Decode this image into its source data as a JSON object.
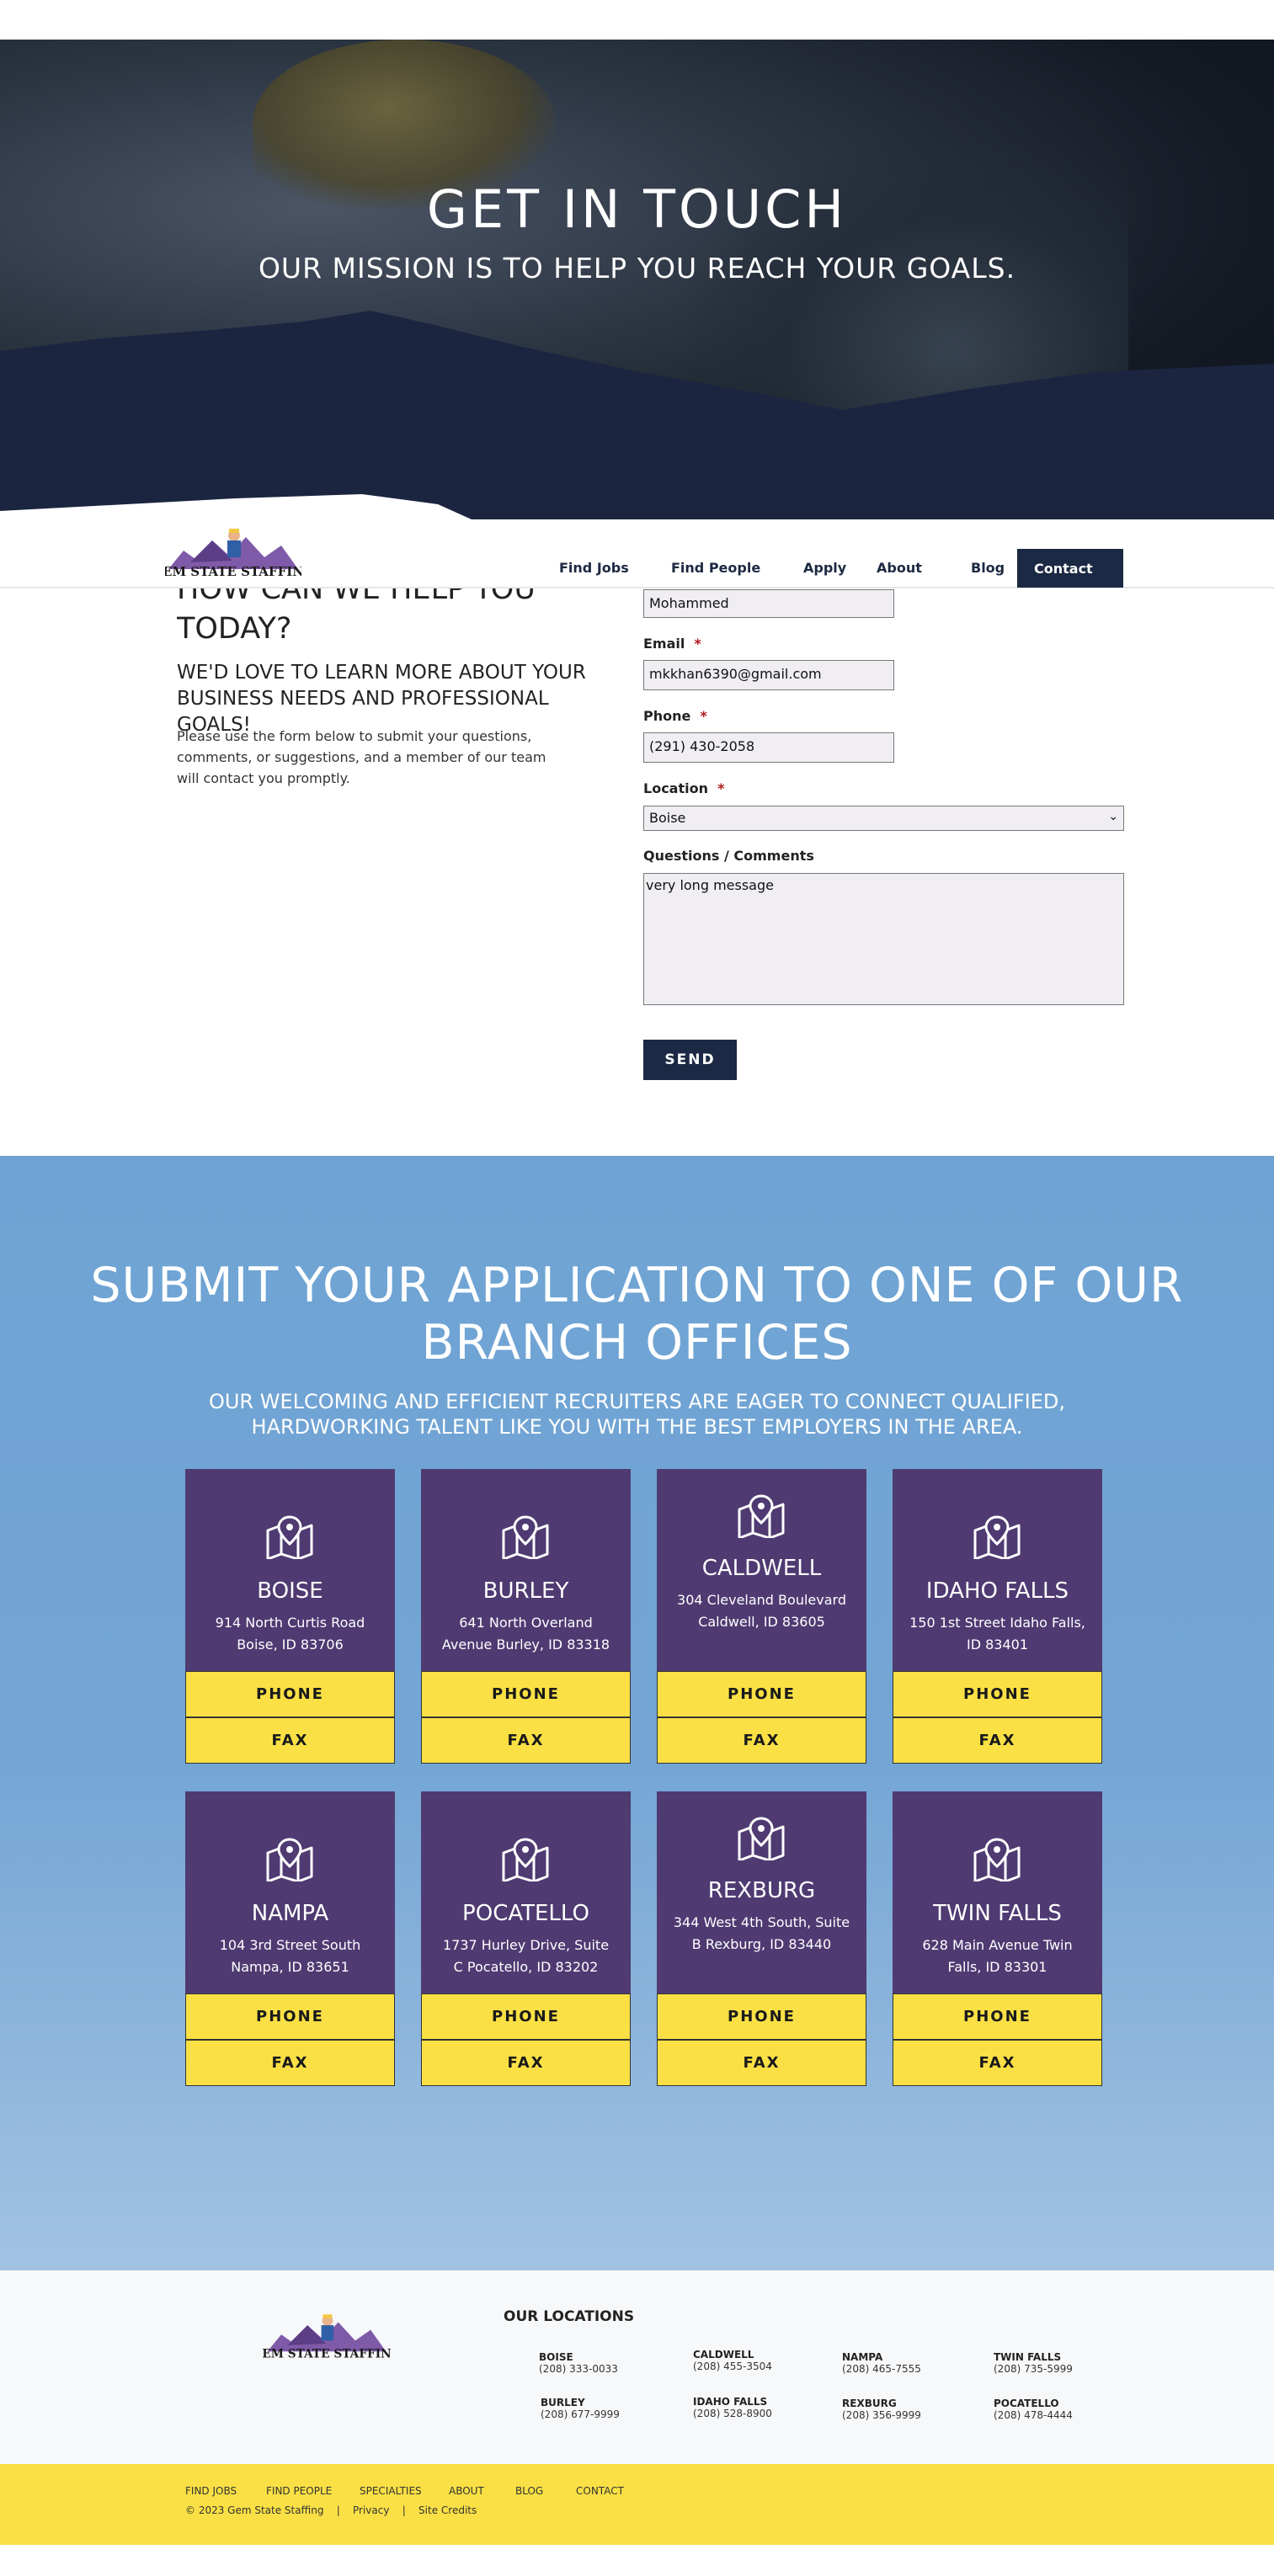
{
  "hero": {
    "title": "GET IN TOUCH",
    "subtitle": "OUR MISSION IS TO HELP YOU REACH YOUR GOALS."
  },
  "nav": {
    "logo_text": "GEM STATE STAFFING",
    "links": [
      "Find Jobs",
      "Find People",
      "Apply",
      "About",
      "Blog"
    ],
    "contact": "Contact"
  },
  "intro": {
    "title": "HOW CAN WE HELP YOU TODAY?",
    "subtitle": "WE'D LOVE TO LEARN MORE ABOUT YOUR BUSINESS NEEDS AND PROFESSIONAL GOALS!",
    "text": "Please use the form below to submit your questions, comments, or suggestions, and a member of our team will contact you promptly."
  },
  "form": {
    "name_value": "Mohammed",
    "email_label": "Email",
    "email_value": "mkkhan6390@gmail.com",
    "phone_label": "Phone",
    "phone_value": "(291) 430-2058",
    "location_label": "Location",
    "location_value": "Boise",
    "comments_label": "Questions / Comments",
    "comments_value": "very long message",
    "required_mark": "*",
    "send": "SEND"
  },
  "branches": {
    "title": "SUBMIT YOUR APPLICATION TO ONE OF OUR BRANCH OFFICES",
    "subtitle": "OUR WELCOMING AND EFFICIENT RECRUITERS ARE EAGER TO CONNECT QUALIFIED, HARDWORKING TALENT LIKE YOU WITH THE BEST EMPLOYERS IN THE AREA.",
    "phone_label": "PHONE",
    "fax_label": "FAX",
    "offices": [
      {
        "name": "BOISE",
        "address": "914 North Curtis Road Boise, ID 83706"
      },
      {
        "name": "BURLEY",
        "address": "641 North Overland Avenue Burley, ID 83318"
      },
      {
        "name": "CALDWELL",
        "address": "304 Cleveland Boulevard Caldwell, ID 83605"
      },
      {
        "name": "IDAHO FALLS",
        "address": "150 1st Street Idaho Falls, ID 83401"
      },
      {
        "name": "NAMPA",
        "address": "104 3rd Street South Nampa, ID 83651"
      },
      {
        "name": "POCATELLO",
        "address": "1737 Hurley Drive, Suite C Pocatello, ID 83202"
      },
      {
        "name": "REXBURG",
        "address": "344 West 4th South, Suite B Rexburg, ID 83440"
      },
      {
        "name": "TWIN FALLS",
        "address": "628 Main Avenue Twin Falls, ID 83301"
      }
    ]
  },
  "footer": {
    "locations_title": "OUR LOCATIONS",
    "locations": [
      {
        "name": "BOISE",
        "phone": "(208) 333-0033"
      },
      {
        "name": "CALDWELL",
        "phone": "(208) 455-3504"
      },
      {
        "name": "NAMPA",
        "phone": "(208) 465-7555"
      },
      {
        "name": "TWIN FALLS",
        "phone": "(208) 735-5999"
      },
      {
        "name": "BURLEY",
        "phone": "(208) 677-9999"
      },
      {
        "name": "IDAHO FALLS",
        "phone": "(208) 528-8900"
      },
      {
        "name": "REXBURG",
        "phone": "(208) 356-9999"
      },
      {
        "name": "POCATELLO",
        "phone": "(208) 478-4444"
      }
    ],
    "links": [
      "FIND JOBS",
      "FIND PEOPLE",
      "SPECIALTIES",
      "ABOUT",
      "BLOG",
      "CONTACT"
    ],
    "copyright": "© 2023 Gem State Staffing",
    "privacy": "Privacy",
    "site_credits": "Site Credits",
    "separator": "|"
  },
  "colors": {
    "navy": "#1c2944",
    "purple": "#4f3a72",
    "yellow": "#fae045",
    "sky": "#6ea3d3"
  }
}
